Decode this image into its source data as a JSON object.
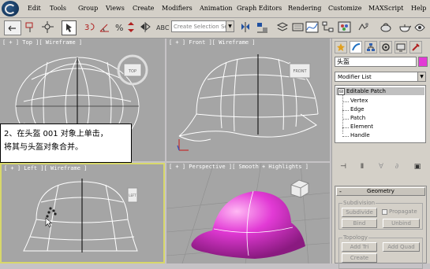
{
  "menu": {
    "items": [
      "Edit",
      "Tools",
      "Group",
      "Views",
      "Create",
      "Modifiers",
      "Animation",
      "Graph Editors",
      "Rendering",
      "Customize",
      "MAXScript",
      "Help"
    ]
  },
  "toolbar": {
    "selection_set_placeholder": "Create Selection Set",
    "icons": [
      "undo-icon",
      "select-link-icon",
      "unlink-icon",
      "bind-space-warp-icon",
      "select-object-icon",
      "select-by-name-icon",
      "selection-region-icon",
      "select-move-icon",
      "select-rotate-icon",
      "select-scale-icon",
      "reference-coord-icon",
      "pivot-icon",
      "snap-3-icon",
      "angle-snap-icon",
      "percent-snap-icon",
      "spinner-snap-icon",
      "named-selection-icon",
      "mirror-icon",
      "align-icon",
      "layer-icon",
      "curve-editor-icon",
      "schematic-icon",
      "material-editor-icon",
      "render-setup-icon",
      "quick-render-icon",
      "render-teapot-icon"
    ]
  },
  "viewports": {
    "top": {
      "label": "[ + ] Top ][ Wireframe ]",
      "cube_label": "TOP"
    },
    "front": {
      "label": "[ + ] Front ][ Wireframe ]",
      "cube_label": "FRONT"
    },
    "left": {
      "label": "[ + ] Left ][ Wireframe ]",
      "cube_label": "LEFT"
    },
    "perspective": {
      "label": "[ + ] Perspective ][ Smooth + Highlights ]"
    }
  },
  "callout": {
    "line1": "2、在头盔 001 对象上单击，",
    "line2": "将其与头盔对象合并。"
  },
  "command_panel": {
    "object_name": "头盔",
    "object_color": "#e23ad5",
    "modifier_list": "Modifier List",
    "stack_top": "Editable Patch",
    "stack_expand": "⊟",
    "sub_objects": [
      "Vertex",
      "Edge",
      "Patch",
      "Element",
      "Handle"
    ],
    "rollout": {
      "title": "Geometry",
      "collapse_symbol": "-",
      "subdivision": {
        "title": "Subdivision",
        "subdivide": "Subdivide",
        "propagate": "Propagate",
        "bind": "Bind",
        "unbind": "Unbind"
      },
      "topology": {
        "title": "Topology",
        "add_tri": "Add Tri",
        "add_quad": "Add Quad",
        "create": "Create"
      }
    }
  }
}
